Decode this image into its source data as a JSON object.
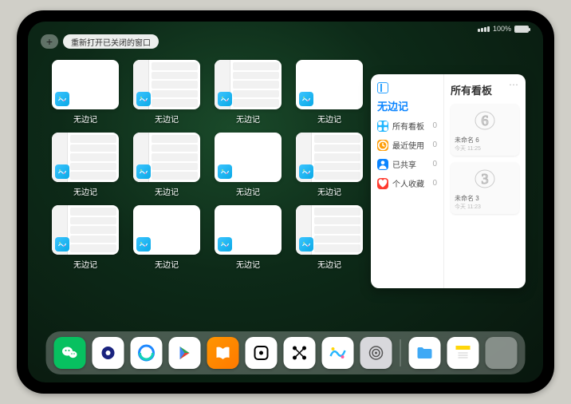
{
  "status": {
    "battery_pct": "100%"
  },
  "topbar": {
    "plus": "+",
    "reopen_label": "重新打开已关闭的窗口"
  },
  "app_title": "无边记",
  "thumbnails": [
    {
      "label": "无边记",
      "variant": "blank"
    },
    {
      "label": "无边记",
      "variant": "cal"
    },
    {
      "label": "无边记",
      "variant": "cal"
    },
    {
      "label": "无边记",
      "variant": "blank"
    },
    {
      "label": "无边记",
      "variant": "cal"
    },
    {
      "label": "无边记",
      "variant": "cal"
    },
    {
      "label": "无边记",
      "variant": "blank"
    },
    {
      "label": "无边记",
      "variant": "cal"
    },
    {
      "label": "无边记",
      "variant": "cal"
    },
    {
      "label": "无边记",
      "variant": "blank"
    },
    {
      "label": "无边记",
      "variant": "blank"
    },
    {
      "label": "无边记",
      "variant": "cal"
    }
  ],
  "panel": {
    "left_title": "无边记",
    "right_title": "所有看板",
    "items": [
      {
        "label": "所有看板",
        "count": "0",
        "color": "#1fb6ff",
        "glyph": "grid"
      },
      {
        "label": "最近使用",
        "count": "0",
        "color": "#ff9f0a",
        "glyph": "clock"
      },
      {
        "label": "已共享",
        "count": "0",
        "color": "#0a84ff",
        "glyph": "person"
      },
      {
        "label": "个人收藏",
        "count": "0",
        "color": "#ff3b30",
        "glyph": "heart"
      }
    ],
    "boards": [
      {
        "name": "未命名 6",
        "time": "今天 11:25",
        "sketch": "6"
      },
      {
        "name": "未命名 3",
        "time": "今天 11:23",
        "sketch": "3"
      }
    ],
    "more": "⋯"
  },
  "dock": [
    {
      "name": "wechat",
      "bg": "#07c160"
    },
    {
      "name": "quark",
      "bg": "#fff"
    },
    {
      "name": "qqbrowser",
      "bg": "#fff"
    },
    {
      "name": "play",
      "bg": "#fff"
    },
    {
      "name": "books",
      "bg": "linear-gradient(135deg,#ff9500,#ff7a00)"
    },
    {
      "name": "dice",
      "bg": "#fff"
    },
    {
      "name": "nodes",
      "bg": "#fff"
    },
    {
      "name": "freeform",
      "bg": "#fff"
    },
    {
      "name": "settings",
      "bg": "#d8d8dc"
    },
    {
      "name": "files",
      "bg": "#fff"
    },
    {
      "name": "notes",
      "bg": "#fff"
    },
    {
      "name": "folder",
      "bg": "folder"
    }
  ]
}
